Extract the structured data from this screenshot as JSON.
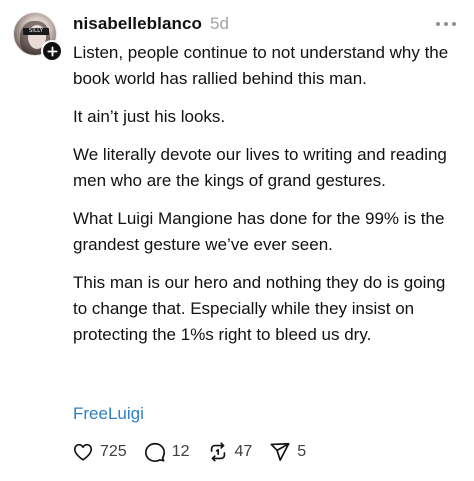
{
  "post": {
    "username": "nisabelleblanco",
    "time": "5d",
    "avatar_tag": "SILLY",
    "paragraphs": [
      "Listen, people continue to not understand why the book world has rallied behind this man.",
      "It ain’t just his looks.",
      "We literally devote our lives to writing and reading men who are the kings of grand gestures.",
      "What Luigi Mangione has done for the 99% is the grandest gesture we’ve ever seen.",
      "This man is our hero and nothing they do is going to change that. Especially while they insist on protecting the 1%s right to bleed us dry."
    ],
    "hashtag": "FreeLuigi"
  },
  "actions": {
    "likes": "725",
    "replies": "12",
    "reposts": "47",
    "shares": "5"
  },
  "icons": {
    "like": "heart-icon",
    "reply": "comment-bubble-icon",
    "repost": "repost-icon",
    "share": "send-icon",
    "more": "more-options-icon",
    "follow": "plus-icon"
  },
  "colors": {
    "text": "#111111",
    "meta": "#a3a3a3",
    "hashtag": "#2d7fc8"
  }
}
